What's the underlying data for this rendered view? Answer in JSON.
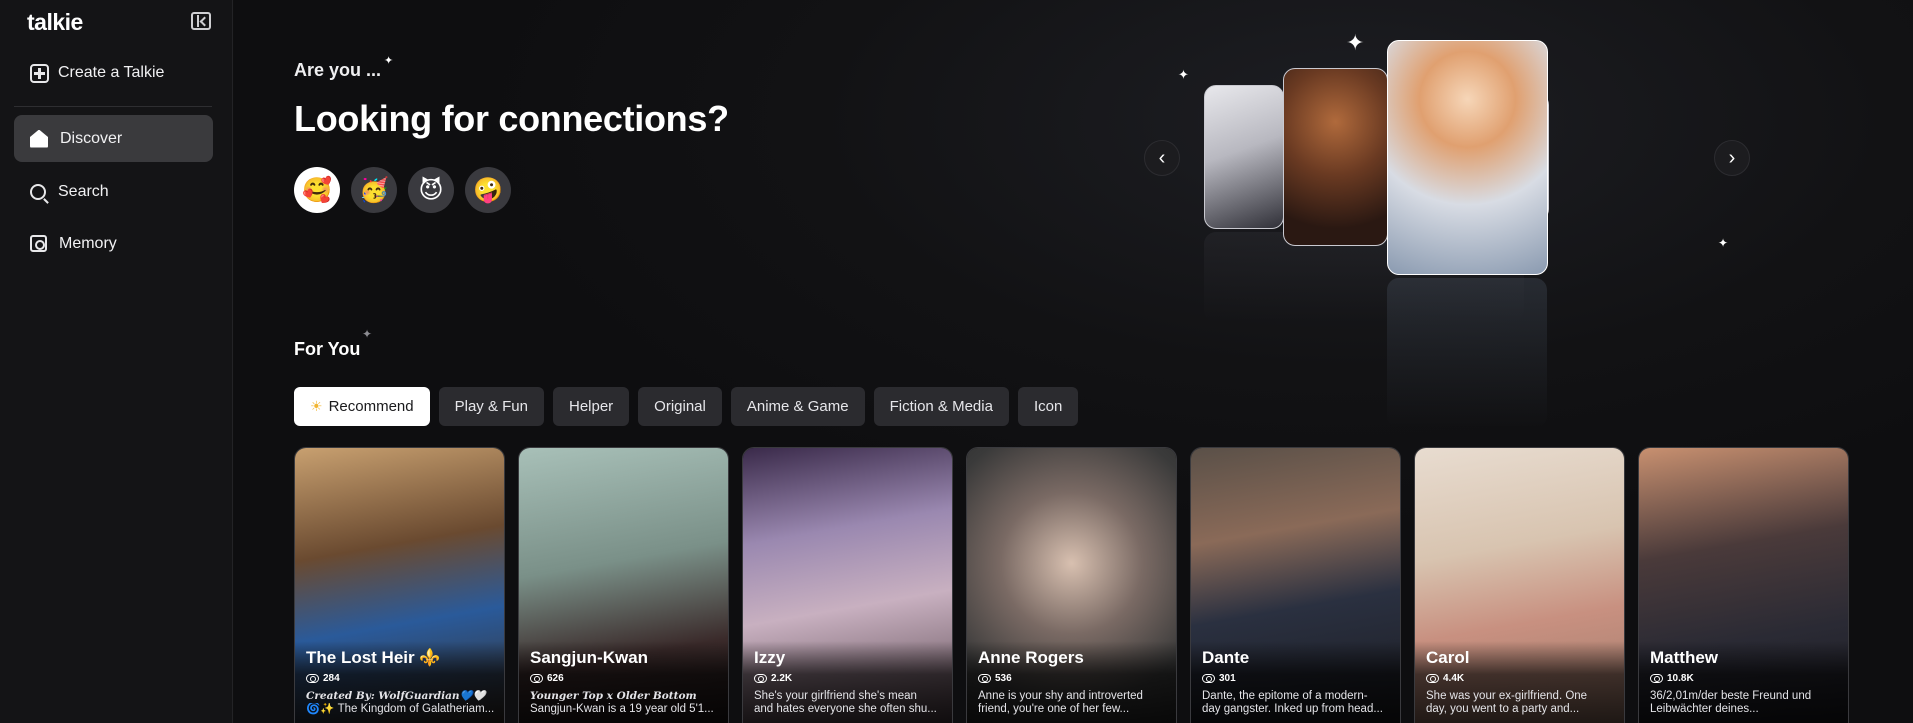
{
  "sidebar": {
    "logo": "talkie",
    "create_label": "Create a Talkie",
    "nav": [
      {
        "label": "Discover",
        "icon": "home-icon",
        "active": true
      },
      {
        "label": "Search",
        "icon": "search-icon",
        "active": false
      },
      {
        "label": "Memory",
        "icon": "memory-icon",
        "active": false
      }
    ]
  },
  "hero": {
    "eyebrow": "Are you ...",
    "title": "Looking for connections?",
    "emojis": [
      {
        "glyph": "🥰",
        "name": "smiling-hearts-emoji",
        "selected": true
      },
      {
        "glyph": "🥳",
        "name": "party-face-emoji",
        "selected": false
      },
      {
        "glyph": "😈",
        "name": "smiling-devil-emoji",
        "selected": false
      },
      {
        "glyph": "🤪",
        "name": "zany-face-emoji",
        "selected": false
      }
    ],
    "prev_glyph": "‹",
    "next_glyph": "›"
  },
  "for_you": {
    "title": "For You",
    "tabs": [
      {
        "label": "Recommend",
        "active": true,
        "icon": "sun-icon"
      },
      {
        "label": "Play & Fun",
        "active": false
      },
      {
        "label": "Helper",
        "active": false
      },
      {
        "label": "Original",
        "active": false
      },
      {
        "label": "Anime & Game",
        "active": false
      },
      {
        "label": "Fiction & Media",
        "active": false
      },
      {
        "label": "Icon",
        "active": false
      }
    ],
    "cards": [
      {
        "name": "The Lost Heir ⚜️",
        "views": "284",
        "line1": "Created By: WolfGuardian💙🤍",
        "line2": "🌀✨ The Kingdom of Galatheriam...",
        "creator": true
      },
      {
        "name": "Sangjun-Kwan",
        "views": "626",
        "line1": "Younger Top x Older Bottom",
        "line2": "Sangjun-Kwan is a 19 year old 5'1...",
        "creator": true
      },
      {
        "name": "Izzy",
        "views": "2.2K",
        "line1": "She's your girlfriend she's mean",
        "line2": "and hates everyone she often shu...",
        "creator": false
      },
      {
        "name": "Anne Rogers",
        "views": "536",
        "line1": "Anne is your shy and introverted",
        "line2": "friend, you're one of her few...",
        "creator": false
      },
      {
        "name": "Dante",
        "views": "301",
        "line1": "Dante, the epitome of a modern-",
        "line2": "day gangster. Inked up from head...",
        "creator": false
      },
      {
        "name": "Carol",
        "views": "4.4K",
        "line1": "She was your ex-girlfriend. One",
        "line2": "day, you went to a party and...",
        "creator": false
      },
      {
        "name": "Matthew",
        "views": "10.8K",
        "line1": "36/2,01m/der beste Freund und",
        "line2": "Leibwächter deines...",
        "creator": false
      }
    ]
  }
}
